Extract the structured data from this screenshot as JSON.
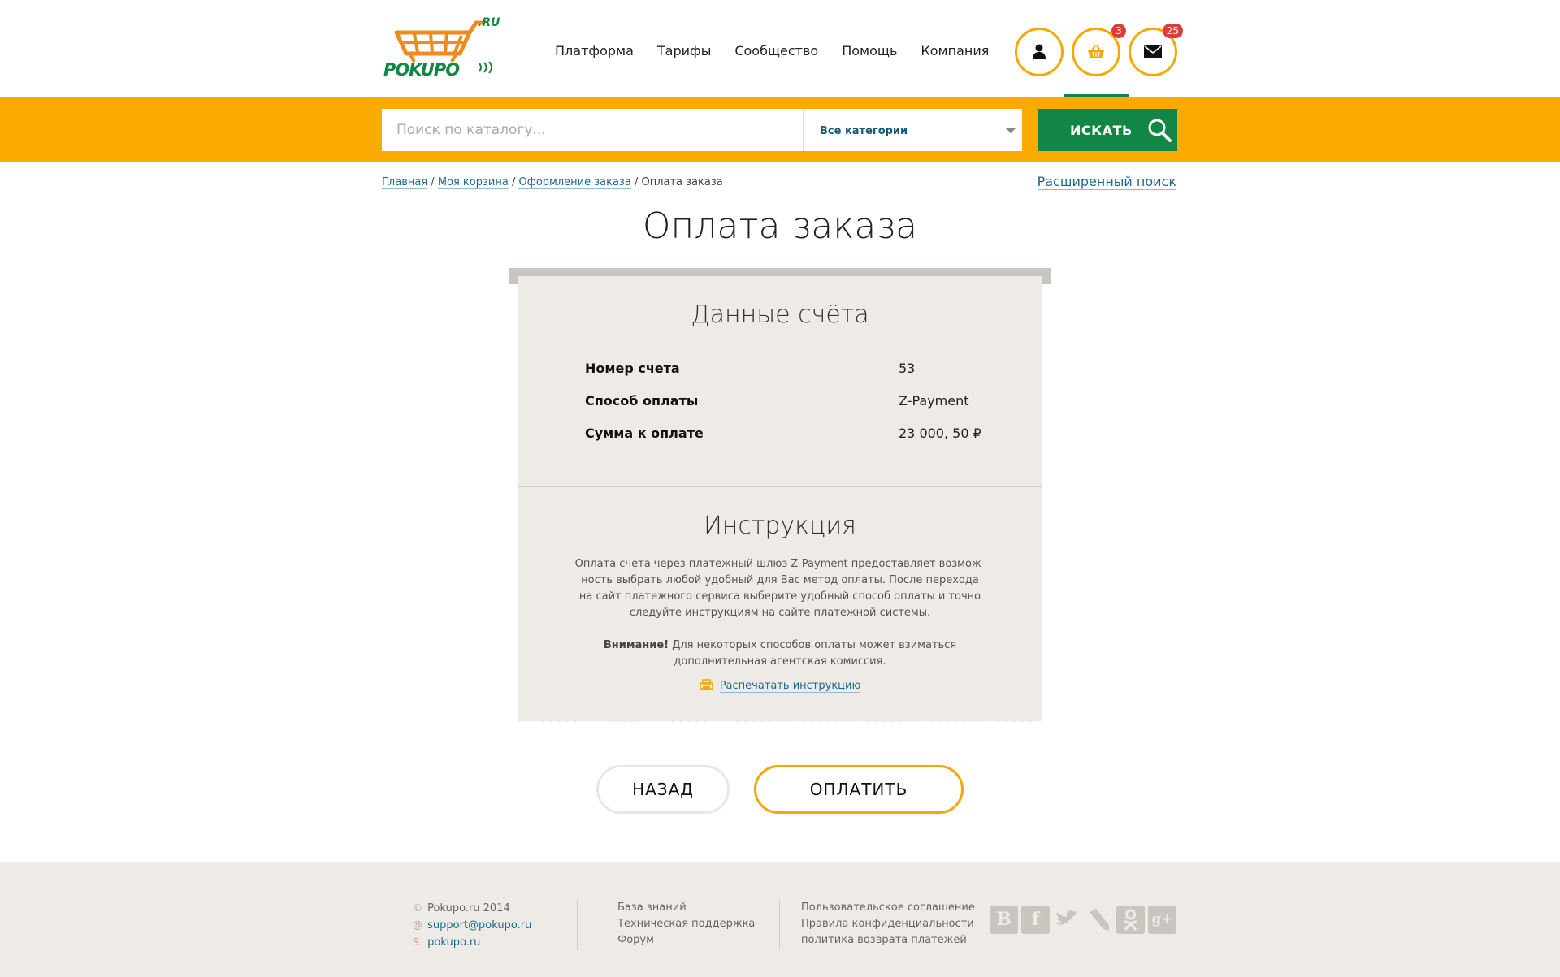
{
  "header": {
    "logo_text": "POKUPO",
    "logo_suffix": ".RU",
    "nav": [
      "Платформа",
      "Тарифы",
      "Сообщество",
      "Помощь",
      "Компания"
    ],
    "cart_count": "3",
    "messages_count": "25"
  },
  "search": {
    "placeholder": "Поиск по каталогу...",
    "category": "Все категории",
    "button": "ИСКАТЬ"
  },
  "breadcrumb": {
    "items": [
      "Главная",
      "Моя корзина",
      "Оформление заказа"
    ],
    "current": "Оплата заказа",
    "advanced_search": "Расширенный поиск"
  },
  "page_title": "Оплата заказа",
  "invoice": {
    "title": "Данные счёта",
    "rows": [
      {
        "label": "Номер счета",
        "value": "53"
      },
      {
        "label": "Способ оплаты",
        "value": "Z-Payment"
      },
      {
        "label": "Сумма к оплате",
        "value": "23 000, 50 ₽"
      }
    ]
  },
  "instructions": {
    "title": "Инструкция",
    "text": "Оплата счета через платежный шлюз Z-Payment предоставляет возмож-ность выбрать любой удобный для Вас метод оплаты. После перехода на сайт платежного сервиса выберите удобный способ оплаты и точно следуйте инструкциям на сайте платежной системы.",
    "warning_label": "Внимание!",
    "warning_text": "Для некоторых способов оплаты может взиматься дополнительная агентская комиссия.",
    "print_link": "Распечатать инструкцию"
  },
  "buttons": {
    "back": "НАЗАД",
    "pay": "ОПЛАТИТЬ"
  },
  "footer": {
    "copyright": "Pokupo.ru 2014",
    "email": "support@pokupo.ru",
    "skype": "pokupo.ru",
    "col2": [
      "База знаний",
      "Техническая поддержка",
      "Форум"
    ],
    "col3": [
      "Пользовательское соглашение",
      "Правила конфиденциальности",
      "политика возврата платежей"
    ],
    "social": [
      "vk-icon",
      "facebook-icon",
      "twitter-icon",
      "livejournal-icon",
      "odnoklassniki-icon",
      "google-plus-icon"
    ]
  },
  "colors": {
    "accent_orange": "#fbaa00",
    "brand_green": "#128745",
    "badge_red": "#e23a3a"
  }
}
